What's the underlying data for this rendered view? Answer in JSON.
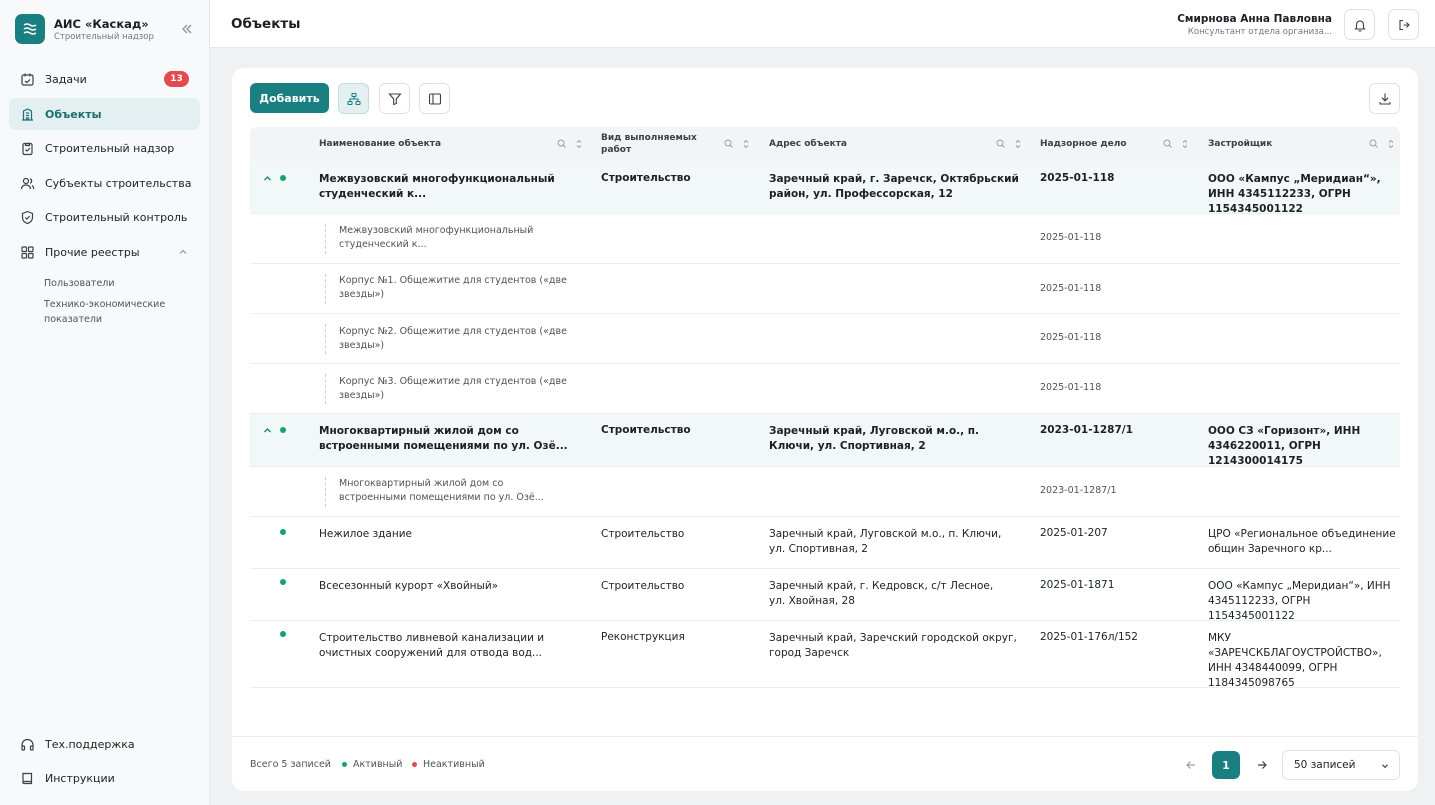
{
  "app": {
    "title": "АИС «Каскад»",
    "subtitle": "Строительный надзор"
  },
  "sidebar": {
    "items": [
      {
        "label": "Задачи",
        "badge": "13"
      },
      {
        "label": "Объекты"
      },
      {
        "label": "Строительный надзор"
      },
      {
        "label": "Субъекты строительства"
      },
      {
        "label": "Строительный контроль"
      },
      {
        "label": "Прочие реестры"
      }
    ],
    "sub_items": [
      "Пользователи",
      "Технико-экономические показатели"
    ],
    "bottom": [
      "Тех.поддержка",
      "Инструкции"
    ]
  },
  "header": {
    "title": "Объекты",
    "user_name": "Смирнова Анна Павловна",
    "user_role": "Консультант отдела организа..."
  },
  "toolbar": {
    "add_label": "Добавить"
  },
  "table": {
    "columns": [
      "Наименование объекта",
      "Вид выполняемых работ",
      "Адрес объекта",
      "Надзорное дело",
      "Застройщик"
    ],
    "rows": [
      {
        "name": "Межвузовский многофункциональный студенческий к...",
        "work": "Строительство",
        "address": "Заречный край, г. Заречск, Октябрьский район, ул. Профессорская, 12",
        "case": "2025-01-118",
        "developer": "ООО «Кампус „Меридиан“», ИНН 4345112233, ОГРН 1154345001122"
      },
      {
        "name": "Межвузовский многофункциональный студенческий к...",
        "case": "2025-01-118"
      },
      {
        "name": "Корпус №1. Общежитие для студентов («две звезды»)",
        "case": "2025-01-118"
      },
      {
        "name": "Корпус №2. Общежитие для студентов («две звезды»)",
        "case": "2025-01-118"
      },
      {
        "name": "Корпус №3. Общежитие для студентов («две звезды»)",
        "case": "2025-01-118"
      },
      {
        "name": "Многоквартирный жилой дом со встроенными помещениями по ул. Озё...",
        "work": "Строительство",
        "address": "Заречный край, Луговской м.о., п. Ключи, ул. Спортивная, 2",
        "case": "2023-01-1287/1",
        "developer": "ООО СЗ «Горизонт», ИНН 4346220011, ОГРН 1214300014175"
      },
      {
        "name": "Многоквартирный жилой дом со встроенными помещениями по ул. Озё...",
        "case": "2023-01-1287/1"
      },
      {
        "name": "Нежилое здание",
        "work": "Строительство",
        "address": "Заречный край, Луговской м.о., п. Ключи, ул. Спортивная, 2",
        "case": "2025-01-207",
        "developer": "ЦРО «Региональное объединение общин Заречного кр..."
      },
      {
        "name": "Всесезонный курорт «Хвойный»",
        "work": "Строительство",
        "address": "Заречный край, г. Кедровск, с/т Лесное, ул. Хвойная, 28",
        "case": "2025-01-1871",
        "developer": "ООО «Кампус „Меридиан“», ИНН 4345112233, ОГРН 1154345001122"
      },
      {
        "name": "Строительство ливневой канализации и очистных сооружений для отвода вод...",
        "work": "Реконструкция",
        "address": "Заречный край, Заречский городской округ, город Заречск",
        "case": "2025-01-176л/152",
        "developer": "МКУ «ЗАРЕЧСКБЛАГОУСТРОЙСТВО», ИНН 4348440099, ОГРН 1184345098765"
      }
    ]
  },
  "footer": {
    "total": "Всего 5 записей",
    "legend_active": "Активный",
    "legend_inactive": "Неактивный",
    "page": "1",
    "page_size": "50 записей"
  },
  "colors": {
    "accent": "#1a7f80",
    "active": "#12a56b",
    "inactive": "#e5484d",
    "badge": "#e5484d"
  }
}
